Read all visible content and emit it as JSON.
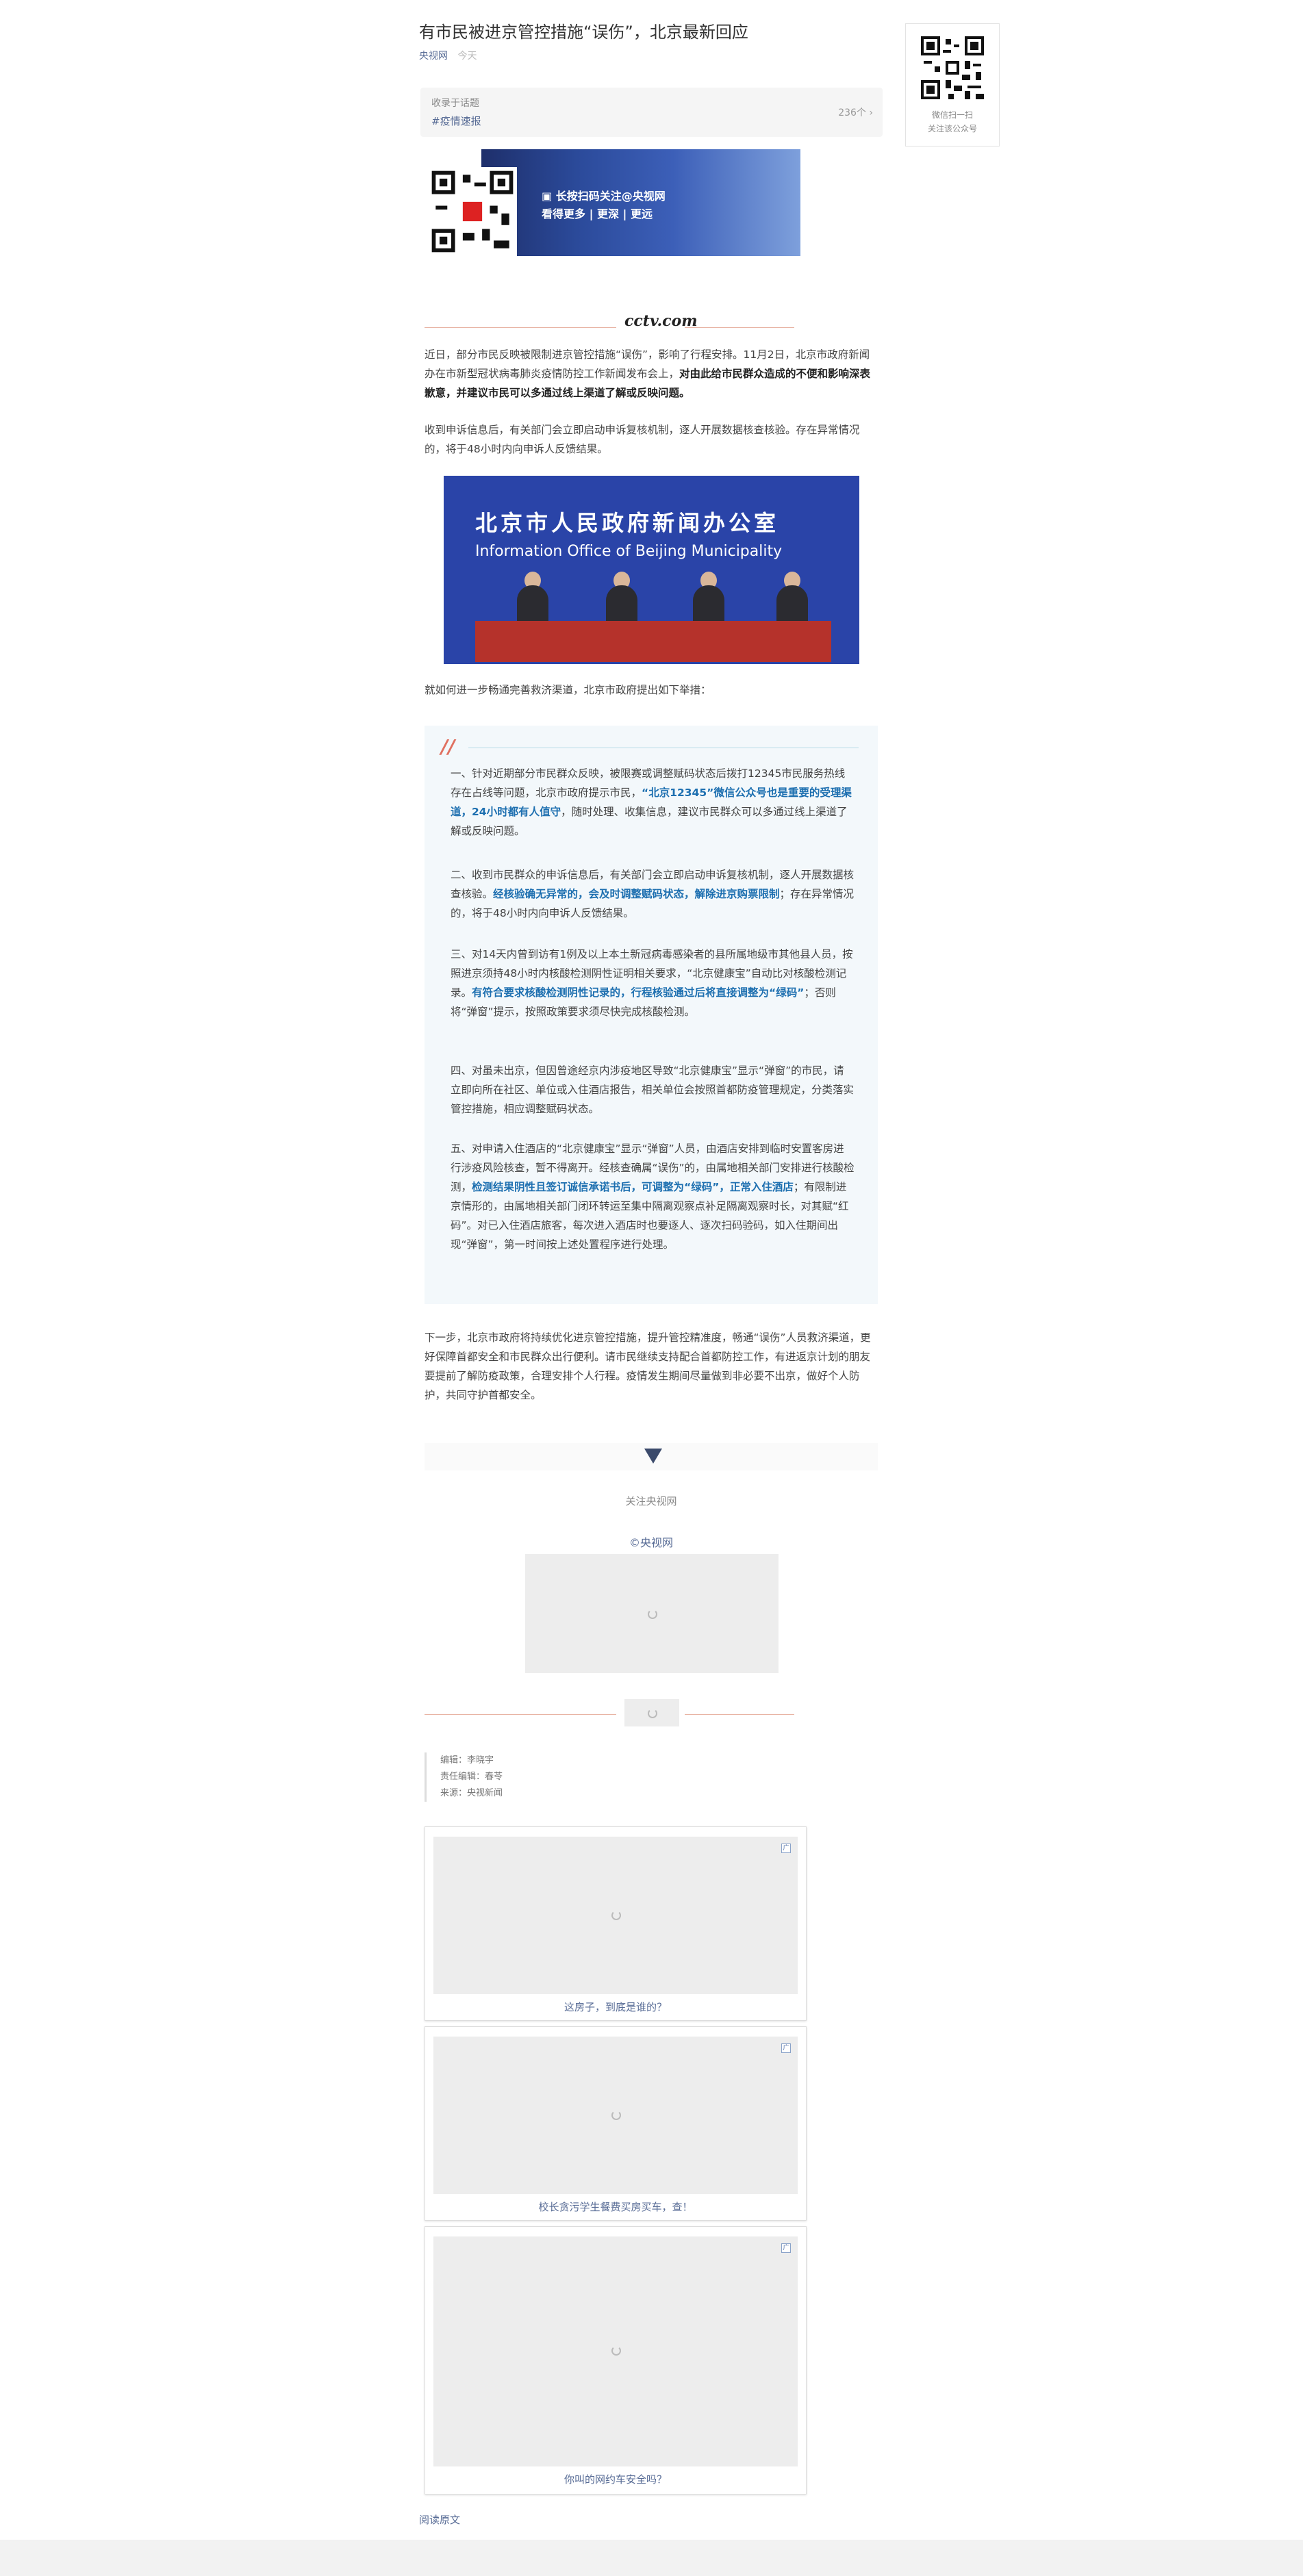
{
  "article": {
    "title": "有市民被进京管控措施“误伤”，北京最新回应",
    "source": "央视网",
    "time_ago": "今天"
  },
  "topic": {
    "label": "收录于话题",
    "tag": "#疫情速报",
    "count": "236个 ›"
  },
  "qr_side": {
    "caption_line1": "微信扫一扫",
    "caption_line2": "关注该公众号"
  },
  "banner": {
    "line1": "▣ 长按扫码关注@央视网",
    "line2": "看得更多 | 更深 | 更远"
  },
  "logo": {
    "text": "cctv.com",
    "small": "央视网"
  },
  "paragraphs": {
    "p1_plain": "近日，部分市民反映被限制进京管控措施“误伤”，影响了行程安排。11月2日，北京市政府新闻办在市新型冠状病毒肺炎疫情防控工作新闻发布会上，",
    "p1_bold": "对由此给市民群众造成的不便和影响深表歉意，并建议市民可以多通过线上渠道了解或反映问题。",
    "p2": "收到申诉信息后，有关部门会立即启动申诉复核机制，逐人开展数据核查核验。存在异常情况的，将于48小时内向申诉人反馈结果。",
    "p3": "就如何进一步畅通完善救济渠道，北京市政府提出如下举措：",
    "p4": "下一步，北京市政府将持续优化进京管控措施，提升管控精准度，畅通“误伤”人员救济渠道，更好保障首都安全和市民群众出行便利。请市民继续支持配合首都防控工作，有进返京计划的朋友要提前了解防疫政策，合理安排个人行程。疫情发生期间尽量做到非必要不出京，做好个人防护，共同守护首都安全。"
  },
  "photo": {
    "title_cn": "北京市人民政府新闻办公室",
    "title_en": "Information Office of Beijing Municipality"
  },
  "measures": {
    "m1_a": "一、针对近期部分市民群众反映，被限赛或调整赋码状态后拨打12345市民服务热线存在占线等问题，北京市政府提示市民，",
    "m1_b": "“北京12345”微信公众号也是重要的受理渠道，24小时都有人值守",
    "m1_c": "，随时处理、收集信息，建议市民群众可以多通过线上渠道了解或反映问题。",
    "m2_a": "二、收到市民群众的申诉信息后，有关部门会立即启动申诉复核机制，逐人开展数据核查核验。",
    "m2_b": "经核验确无异常的，会及时调整赋码状态，解除进京购票限制",
    "m2_c": "；存在异常情况的，将于48小时内向申诉人反馈结果。",
    "m3_a": "三、对14天内曾到访有1例及以上本土新冠病毒感染者的县所属地级市其他县人员，按照进京须持48小时内核酸检测阴性证明相关要求，“北京健康宝”自动比对核酸检测记录。",
    "m3_b": "有符合要求核酸检测阴性记录的，行程核验通过后将直接调整为“绿码”",
    "m3_c": "；否则将“弹窗”提示，按照政策要求须尽快完成核酸检测。",
    "m4": "四、对虽未出京，但因曾途经京内涉疫地区导致“北京健康宝”显示“弹窗”的市民，请立即向所在社区、单位或入住酒店报告，相关单位会按照首都防疫管理规定，分类落实管控措施，相应调整赋码状态。",
    "m5_a": "五、对申请入住酒店的“北京健康宝”显示“弹窗”人员，由酒店安排到临时安置客房进行涉疫风险核查，暂不得离开。经核查确属“误伤”的，由属地相关部门安排进行核酸检测，",
    "m5_b": "检测结果阴性且签订诚信承诺书后，可调整为“绿码”，正常入住酒店",
    "m5_c": "；有限制进京情形的，由属地相关部门闭环转运至集中隔离观察点补足隔离观察时长，对其赋“红码”。对已入住酒店旅客，每次进入酒店时也要逐人、逐次扫码验码，如入住期间出现“弹窗”，第一时间按上述处置程序进行处理。"
  },
  "footer": {
    "follow": "关注央视网",
    "copyright": "©央视网",
    "editor": "编辑：李晓宇",
    "chief_editor": "责任编辑：春苓",
    "origin": "来源：央视新闻"
  },
  "related": [
    {
      "title": "这房子，到底是谁的？",
      "badge": "广"
    },
    {
      "title": "校长贪污学生餐费买房买车，查！",
      "badge": "广"
    },
    {
      "title": "你叫的网约车安全吗？",
      "badge": "广"
    }
  ],
  "read_original": "阅读原文"
}
